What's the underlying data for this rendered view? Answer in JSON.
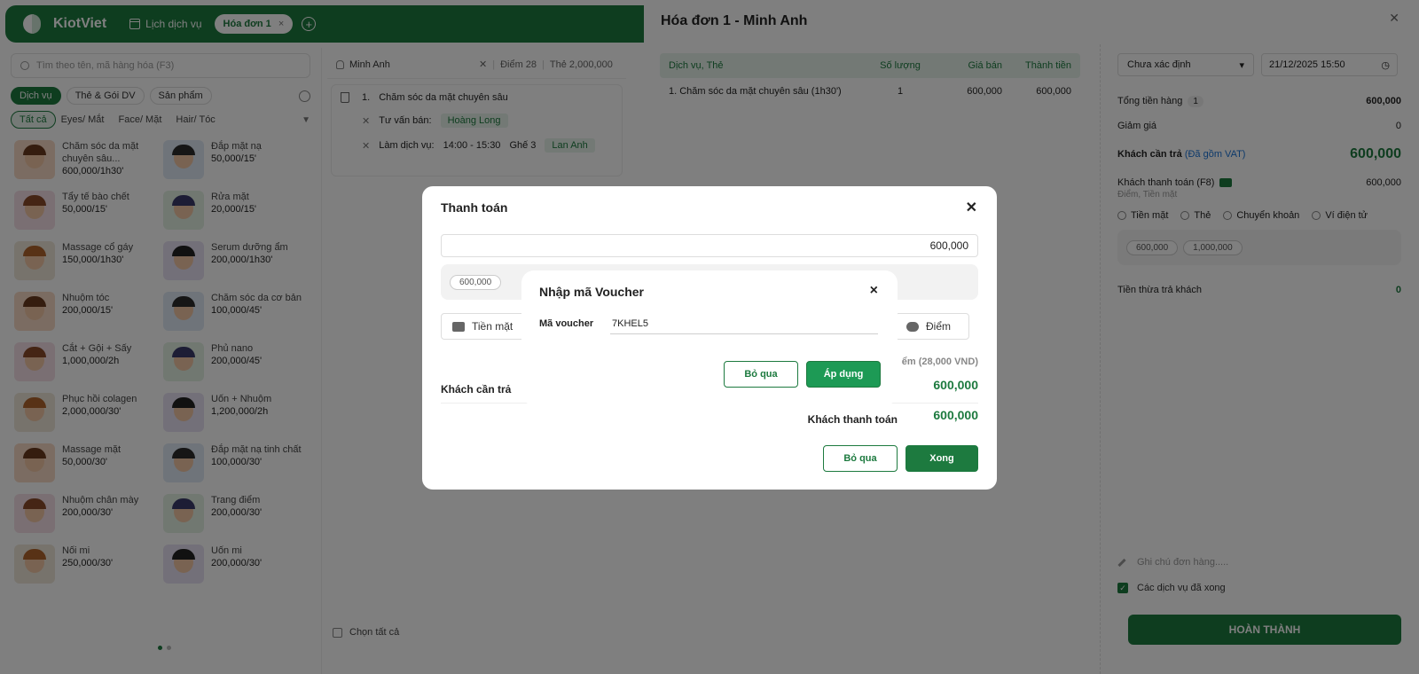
{
  "topbar": {
    "brand": "KiotViet",
    "schedule_link": "Lịch dịch vụ",
    "active_tab": "Hóa đơn 1",
    "tab_close": "×",
    "add_tab": "+"
  },
  "left": {
    "search_placeholder": "Tìm theo tên, mã hàng hóa (F3)",
    "categories": [
      "Dịch vụ",
      "Thẻ & Gói DV",
      "Sản phẩm"
    ],
    "subcategories": [
      "Tất cả",
      "Eyes/ Mắt",
      "Face/ Mặt",
      "Hair/ Tóc"
    ],
    "services": [
      {
        "name": "Chăm sóc da mặt chuyên sâu...",
        "price": "600,000/1h30'"
      },
      {
        "name": "Đắp mặt nạ",
        "price": "50,000/15'"
      },
      {
        "name": "Tẩy tế bào chết",
        "price": "50,000/15'"
      },
      {
        "name": "Rửa mặt",
        "price": "20,000/15'"
      },
      {
        "name": "Massage cổ gáy",
        "price": "150,000/1h30'"
      },
      {
        "name": "Serum dưỡng ẩm",
        "price": "200,000/1h30'"
      },
      {
        "name": "Nhuộm tóc",
        "price": "200,000/15'"
      },
      {
        "name": "Chăm sóc da cơ bản",
        "price": "100,000/45'"
      },
      {
        "name": "Cắt + Gội + Sấy",
        "price": "1,000,000/2h"
      },
      {
        "name": "Phủ nano",
        "price": "200,000/45'"
      },
      {
        "name": "Phục hồi colagen",
        "price": "2,000,000/30'"
      },
      {
        "name": "Uốn + Nhuộm",
        "price": "1,200,000/2h"
      },
      {
        "name": "Massage mặt",
        "price": "50,000/30'"
      },
      {
        "name": "Đắp mặt nạ tinh chất",
        "price": "100,000/30'"
      },
      {
        "name": "Nhuộm chân mày",
        "price": "200,000/30'"
      },
      {
        "name": "Trang điểm",
        "price": "200,000/30'"
      },
      {
        "name": "Nối mi",
        "price": "250,000/30'"
      },
      {
        "name": "Uốn mi",
        "price": "200,000/30'"
      }
    ]
  },
  "middle": {
    "customer": "Minh Anh",
    "points": "Điểm 28",
    "card": "Thẻ 2,000,000",
    "order_index": "1.",
    "order_item": "Chăm sóc da mặt chuyên sâu",
    "consultant_label": "Tư vấn bán:",
    "consultant": "Hoàng Long",
    "service_label": "Làm dịch vụ:",
    "time": "14:00 - 15:30",
    "chair": "Ghế 3",
    "staff": "Lan Anh",
    "select_all": "Chọn tất cả"
  },
  "invoice": {
    "title": "Hóa đơn 1 - Minh Anh",
    "headers": [
      "Dịch vụ, Thẻ",
      "Số lượng",
      "Giá bán",
      "Thành tiền"
    ],
    "rows": [
      {
        "name": "1.  Chăm sóc da mặt chuyên sâu (1h30')",
        "qty": "1",
        "price": "600,000",
        "total": "600,000"
      }
    ],
    "status_select": "Chưa xác định",
    "datetime": "21/12/2025 15:50",
    "total_goods_label": "Tổng tiền hàng",
    "total_goods_count": "1",
    "total_goods": "600,000",
    "discount_label": "Giảm giá",
    "discount": "0",
    "need_pay_label": "Khách cần trả",
    "vat_note": "(Đã gồm VAT)",
    "need_pay": "600,000",
    "customer_pay_label": "Khách thanh toán (F8)",
    "customer_pay": "600,000",
    "customer_pay_note": "Điểm, Tiền mặt",
    "methods": [
      "Tiền mặt",
      "Thẻ",
      "Chuyển khoản",
      "Ví điện tử"
    ],
    "quick_amounts": [
      "600,000",
      "1,000,000"
    ],
    "change_label": "Tiền thừa trả khách",
    "change": "0",
    "note_placeholder": "Ghi chú đơn hàng.....",
    "services_done": "Các dịch vụ đã xong",
    "finish": "HOÀN THÀNH"
  },
  "payment": {
    "title": "Thanh toán",
    "amount": "600,000",
    "quick_amount": "600,000",
    "method_cash": "Tiền mặt",
    "method_points": "Điểm",
    "points_note": "ểm (28,000 VND)",
    "need_pay_label": "Khách cần trả",
    "need_pay": "600,000",
    "paid_label": "Khách thanh toán",
    "paid": "600,000",
    "cancel": "Bỏ qua",
    "done": "Xong"
  },
  "voucher": {
    "title": "Nhập mã Voucher",
    "label": "Mã voucher",
    "code": "7KHEL5",
    "cancel": "Bỏ qua",
    "apply": "Áp dụng",
    "close": "×"
  }
}
